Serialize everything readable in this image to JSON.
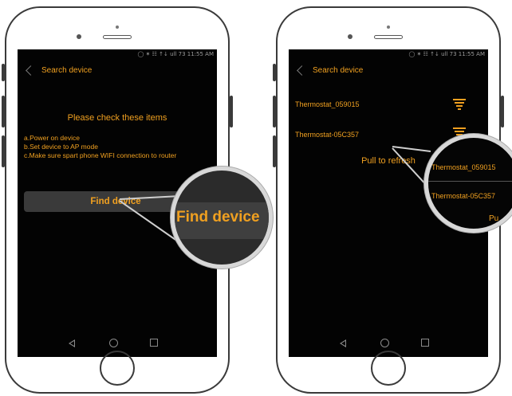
{
  "left_phone": {
    "status_bar": "◯ ✶ ☷ ↑↓ ull 73 11:55 AM",
    "title": "Search device",
    "heading": "Please check these items",
    "instructions": [
      "a.Power on device",
      "b.Set device to AP mode",
      "c.Make sure spart phone WIFI connection to router"
    ],
    "find_button": "Find device",
    "magnified_label": "Find device"
  },
  "right_phone": {
    "status_bar": "◯ ✶ ☷ ↑↓ ull 73 11:55 AM",
    "title": "Search device",
    "devices": [
      {
        "name": "Thermostat_059015",
        "icon": "wifi-signal-icon"
      },
      {
        "name": "Thermostat-05C357",
        "icon": "wifi-signal-icon"
      }
    ],
    "pull_text": "Pull to refresh",
    "magnified": {
      "device1": "Thermostat_059015",
      "device2": "Thermostat-05C357",
      "partial": "Pu"
    }
  },
  "colors": {
    "accent": "#f0a020",
    "screen_bg": "#030303",
    "button_bg": "#3a3a3a"
  }
}
